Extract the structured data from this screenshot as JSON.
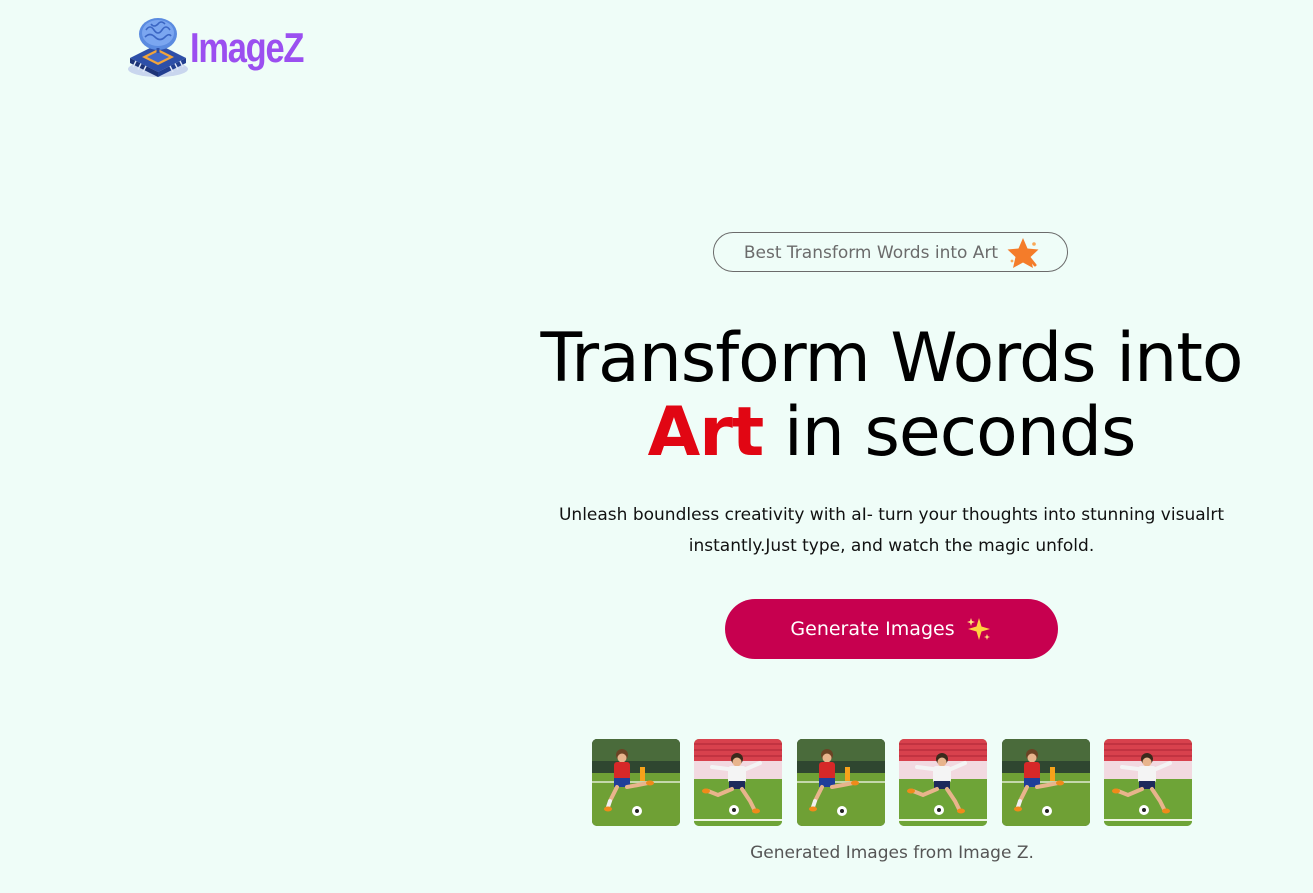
{
  "brand": {
    "name": "ImageZ",
    "icon": "brain-chip-icon",
    "color": "#9b4ff0"
  },
  "badge": {
    "text": "Best Transform Words into Art",
    "icon": "sparkle-star-icon"
  },
  "hero": {
    "title_before": "Transform Words into",
    "title_accent": "Art",
    "title_after": "in seconds",
    "subtitle": "Unleash boundless creativity with aI- turn your thoughts into stunning visualrt instantly.Just type, and watch the magic unfold.",
    "accent_color": "#e10613"
  },
  "cta": {
    "label": "Generate Images",
    "icon": "sparkles-icon",
    "color": "#c7004f"
  },
  "gallery": {
    "caption": "Generated Images from Image Z.",
    "images": [
      {
        "name": "generated-image-1",
        "style": "red-jersey"
      },
      {
        "name": "generated-image-2",
        "style": "white-jersey"
      },
      {
        "name": "generated-image-3",
        "style": "red-jersey"
      },
      {
        "name": "generated-image-4",
        "style": "white-jersey"
      },
      {
        "name": "generated-image-5",
        "style": "red-jersey"
      },
      {
        "name": "generated-image-6",
        "style": "white-jersey"
      }
    ]
  },
  "colors": {
    "background": "#effdf8",
    "badge_text": "#6b6b6b"
  }
}
